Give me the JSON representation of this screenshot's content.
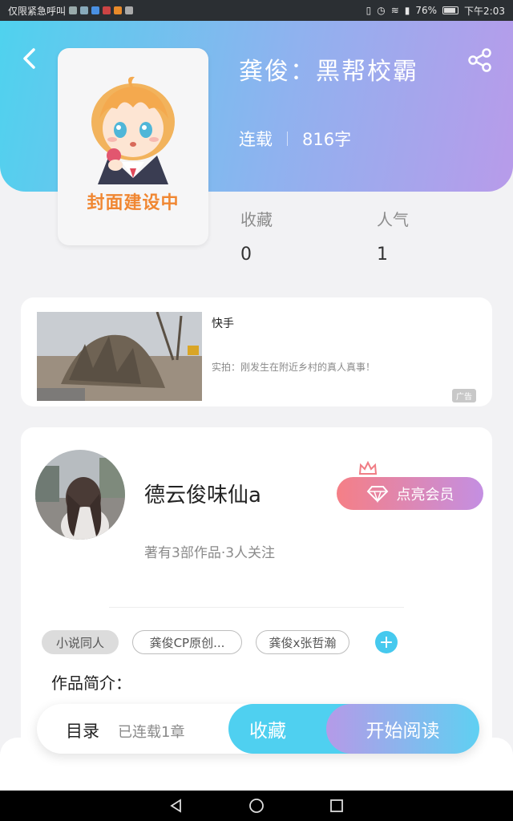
{
  "status_bar": {
    "left_text": "仅限紧急呼叫",
    "battery": "76%",
    "time": "下午2:03"
  },
  "header": {
    "book_title": "龚俊：黑帮校霸",
    "status": "连载",
    "word_count": "816字"
  },
  "cover": {
    "text": "封面建设中"
  },
  "stats": {
    "favorites_label": "收藏",
    "favorites_value": "0",
    "popularity_label": "人气",
    "popularity_value": "1"
  },
  "ad": {
    "source": "快手",
    "description": "实拍：刚发生在附近乡村的真人真事！",
    "tag": "广告"
  },
  "author": {
    "name": "德云俊味仙a",
    "meta": "著有3部作品·3人关注",
    "vip_button": "点亮会员",
    "tags": [
      "小说同人",
      "龚俊CP原创...",
      "龚俊x张哲瀚"
    ],
    "add_tag": "+",
    "intro_label": "作品简介："
  },
  "action_bar": {
    "toc_label": "目录",
    "toc_info": "已连载1章",
    "collect": "收藏",
    "read": "开始阅读"
  },
  "colors": {
    "header_start": "#4fd2ee",
    "header_end": "#b89bea",
    "accent_blue": "#4fd0f0",
    "cover_text": "#f08732",
    "vip_start": "#f57f86",
    "vip_end": "#c48fe2"
  },
  "icons": {
    "back": "back-arrow-icon",
    "share": "share-icon",
    "vip": "diamond-icon",
    "crown": "crown-icon"
  }
}
